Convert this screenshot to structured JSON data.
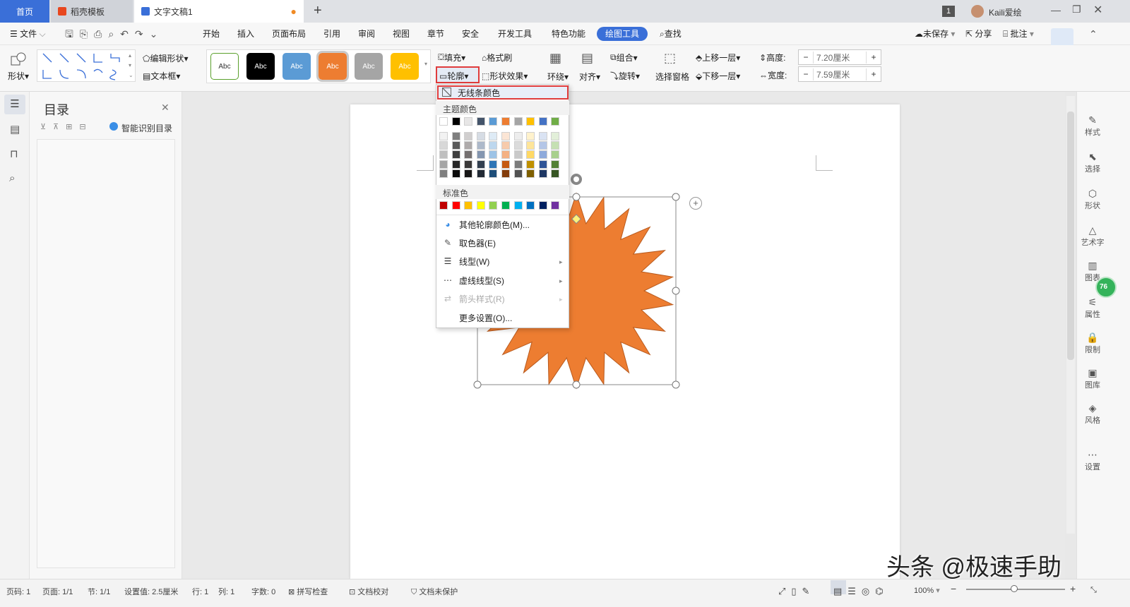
{
  "tabs": {
    "home": "首页",
    "template": "稻壳模板",
    "document": "文字文稿1",
    "new_tab": "+"
  },
  "titlebar": {
    "badge": "1",
    "user": "Kaili爱绘"
  },
  "menu": {
    "file": "文件",
    "items": [
      "开始",
      "插入",
      "页面布局",
      "引用",
      "审阅",
      "视图",
      "章节",
      "安全",
      "开发工具",
      "特色功能"
    ],
    "active": "绘图工具",
    "search": "查找",
    "unsaved": "未保存",
    "share": "分享",
    "comment": "批注"
  },
  "ribbon": {
    "shape": "形状",
    "edit_shape": "编辑形状",
    "textbox": "文本框",
    "style_boxes": [
      {
        "label": "Abc",
        "bg": "#ffffff",
        "fg": "#333333",
        "border": "#5aa02c"
      },
      {
        "label": "Abc",
        "bg": "#000000",
        "fg": "#ffffff",
        "border": "#000000"
      },
      {
        "label": "Abc",
        "bg": "#5b9bd5",
        "fg": "#ffffff",
        "border": "#5b9bd5"
      },
      {
        "label": "Abc",
        "bg": "#ed7d31",
        "fg": "#ffffff",
        "border": "#ed7d31"
      },
      {
        "label": "Abc",
        "bg": "#a5a5a5",
        "fg": "#ffffff",
        "border": "#a5a5a5"
      },
      {
        "label": "Abc",
        "bg": "#ffc000",
        "fg": "#ffffff",
        "border": "#ffc000"
      }
    ],
    "fill": "填充",
    "format_brush": "格式刷",
    "outline": "轮廓",
    "shape_effect": "形状效果",
    "wrap": "环绕",
    "align": "对齐",
    "group": "组合",
    "rotate": "旋转",
    "select_pane": "选择窗格",
    "bring_forward": "上移一层",
    "send_backward": "下移一层",
    "height_label": "高度:",
    "height_value": "7.20厘米",
    "width_label": "宽度:",
    "width_value": "7.59厘米",
    "minus": "−",
    "plus": "+"
  },
  "toc": {
    "title": "目录",
    "smart": "智能识别目录"
  },
  "dropdown": {
    "no_line": "无线条颜色",
    "theme_colors": "主题颜色",
    "standard_colors": "标准色",
    "more_colors": "其他轮廓颜色(M)...",
    "eyedropper": "取色器(E)",
    "line_type": "线型(W)",
    "dash_type": "虚线线型(S)",
    "arrow_style": "箭头样式(R)",
    "more_settings": "更多设置(O)..."
  },
  "theme_row": [
    "#ffffff",
    "#000000",
    "#e7e6e6",
    "#44546a",
    "#5b9bd5",
    "#ed7d31",
    "#a5a5a5",
    "#ffc000",
    "#4472c4",
    "#70ad47"
  ],
  "theme_shades": [
    [
      "#f2f2f2",
      "#7f7f7f",
      "#d0cece",
      "#d6dce4",
      "#deebf6",
      "#fbe5d5",
      "#ededed",
      "#fff2cc",
      "#dae3f3",
      "#e2efd9"
    ],
    [
      "#d8d8d8",
      "#595959",
      "#aeaaaa",
      "#adb9ca",
      "#bdd7ee",
      "#f7cbac",
      "#dbdbdb",
      "#fee599",
      "#b4c6e7",
      "#c5e0b3"
    ],
    [
      "#bfbfbf",
      "#3f3f3f",
      "#757070",
      "#8496b0",
      "#9dc3e6",
      "#f4b183",
      "#c9c9c9",
      "#ffd965",
      "#8eaadb",
      "#a8d08d"
    ],
    [
      "#a5a5a5",
      "#262626",
      "#3a3838",
      "#323f4f",
      "#2e75b5",
      "#c55a11",
      "#7b7b7b",
      "#bf9000",
      "#2f5496",
      "#538135"
    ],
    [
      "#7f7f7f",
      "#0c0c0c",
      "#171616",
      "#222a35",
      "#1e4e79",
      "#833c0b",
      "#525252",
      "#7f6000",
      "#1f3864",
      "#375623"
    ]
  ],
  "standard_row": [
    "#c00000",
    "#ff0000",
    "#ffc000",
    "#ffff00",
    "#92d050",
    "#00b050",
    "#00b0f0",
    "#0070c0",
    "#002060",
    "#7030a0"
  ],
  "right_panel": [
    "样式",
    "选择",
    "形状",
    "艺术字",
    "图表",
    "属性",
    "限制",
    "图库",
    "风格",
    "设置"
  ],
  "badge_76": "76",
  "status": {
    "page": "页码: 1",
    "pages": "页面: 1/1",
    "section": "节: 1/1",
    "setting": "设置值: 2.5厘米",
    "row": "行: 1",
    "col": "列: 1",
    "words": "字数: 0",
    "spell": "拼写检查",
    "proof": "文档校对",
    "protect": "文档未保护",
    "zoom": "100%"
  },
  "watermark": "头条 @极速手助",
  "colors": {
    "accent": "#3a6fd8",
    "shape": "#ed7d31",
    "highlight": "#e03c3c"
  }
}
